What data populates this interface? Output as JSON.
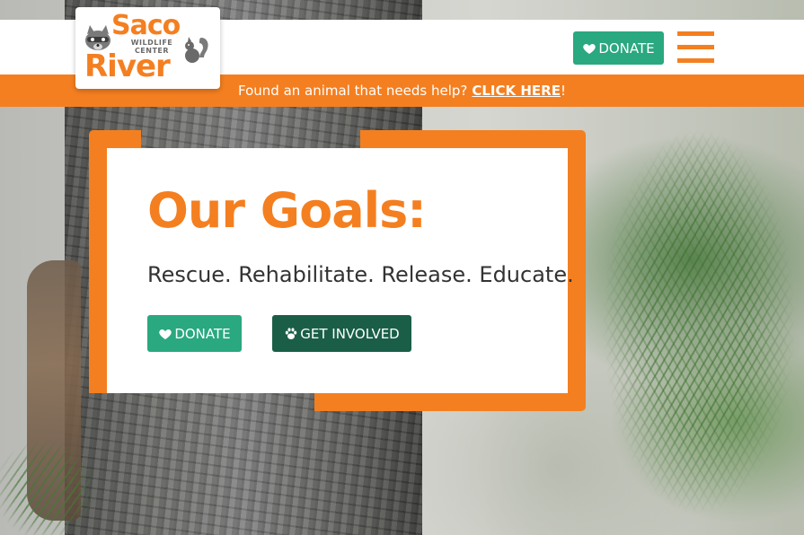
{
  "colors": {
    "brand_orange": "#f47f20",
    "donate_green": "#2aa87f",
    "involved_green": "#1a5e48",
    "text_dark": "#333333"
  },
  "logo": {
    "line1": "Saco",
    "line2": "River",
    "sub1": "WILDLIFE",
    "sub2": "CENTER",
    "icons": [
      "raccoon-icon",
      "squirrel-icon"
    ]
  },
  "header": {
    "donate_label": "DONATE",
    "donate_icon": "heart-icon",
    "menu_icon": "hamburger-menu-icon"
  },
  "alert": {
    "text": "Found an animal that needs help?",
    "link_label": "CLICK HERE",
    "suffix": "!"
  },
  "hero": {
    "title": "Our Goals:",
    "tagline": "Rescue. Rehabilitate. Release. Educate.",
    "donate_label": "DONATE",
    "donate_icon": "heart-icon",
    "involved_label": "GET INVOLVED",
    "involved_icon": "paw-icon"
  }
}
